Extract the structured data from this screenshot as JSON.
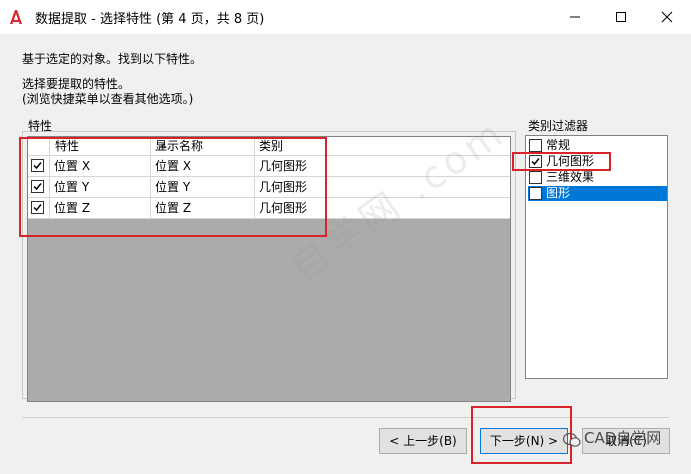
{
  "window": {
    "title": "数据提取 - 选择特性 (第 4 页，共 8 页)",
    "brand_color": "#d8232a"
  },
  "intro": {
    "line1": "基于选定的对象。找到以下特性。",
    "line2": "选择要提取的特性。",
    "line3": "(浏览快捷菜单以查看其他选项。)"
  },
  "properties_panel": {
    "label": "特性",
    "columns": [
      "特性",
      "显示名称",
      "类别"
    ],
    "rows": [
      {
        "checked": true,
        "property": "位置 X",
        "display_name": "位置 X",
        "category": "几何图形"
      },
      {
        "checked": true,
        "property": "位置 Y",
        "display_name": "位置 Y",
        "category": "几何图形"
      },
      {
        "checked": true,
        "property": "位置 Z",
        "display_name": "位置 Z",
        "category": "几何图形"
      }
    ]
  },
  "category_filter": {
    "label": "类别过滤器",
    "items": [
      {
        "label": "常规",
        "checked": false,
        "selected": false
      },
      {
        "label": "几何图形",
        "checked": true,
        "selected": false
      },
      {
        "label": "三维效果",
        "checked": false,
        "selected": false
      },
      {
        "label": "图形",
        "checked": false,
        "selected": true
      }
    ]
  },
  "buttons": {
    "prev": "< 上一步(B)",
    "next": "下一步(N) >",
    "cancel": "取消(C)"
  },
  "watermark": {
    "text": "CAD自学网",
    "diagonal": "自学网 .com"
  }
}
